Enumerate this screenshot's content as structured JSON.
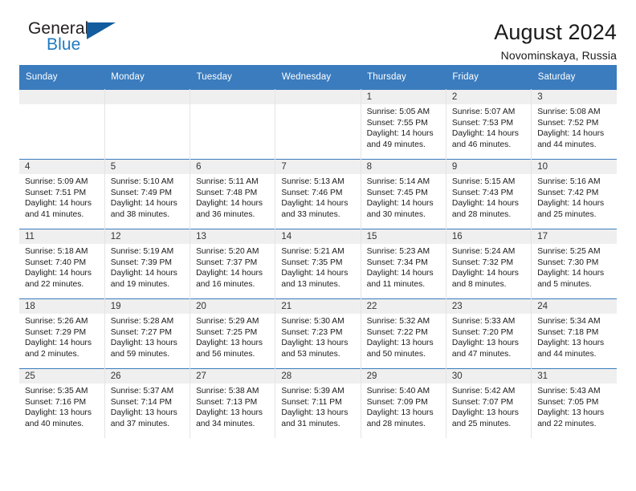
{
  "brand": {
    "name_part1": "General",
    "name_part2": "Blue",
    "accent_color": "#1f7bc1",
    "triangle_color": "#135d9e"
  },
  "header": {
    "title": "August 2024",
    "subtitle": "Novominskaya, Russia",
    "header_bg_color": "#3a7cbe"
  },
  "weekday_headers": [
    "Sunday",
    "Monday",
    "Tuesday",
    "Wednesday",
    "Thursday",
    "Friday",
    "Saturday"
  ],
  "labels": {
    "sunrise_prefix": "Sunrise:",
    "sunset_prefix": "Sunset:",
    "daylight_prefix": "Daylight:"
  },
  "weeks": [
    [
      {
        "day": "",
        "empty": true
      },
      {
        "day": "",
        "empty": true
      },
      {
        "day": "",
        "empty": true
      },
      {
        "day": "",
        "empty": true
      },
      {
        "day": "1",
        "sunrise": "Sunrise: 5:05 AM",
        "sunset": "Sunset: 7:55 PM",
        "daylight_line1": "Daylight: 14 hours",
        "daylight_line2": "and 49 minutes."
      },
      {
        "day": "2",
        "sunrise": "Sunrise: 5:07 AM",
        "sunset": "Sunset: 7:53 PM",
        "daylight_line1": "Daylight: 14 hours",
        "daylight_line2": "and 46 minutes."
      },
      {
        "day": "3",
        "sunrise": "Sunrise: 5:08 AM",
        "sunset": "Sunset: 7:52 PM",
        "daylight_line1": "Daylight: 14 hours",
        "daylight_line2": "and 44 minutes."
      }
    ],
    [
      {
        "day": "4",
        "sunrise": "Sunrise: 5:09 AM",
        "sunset": "Sunset: 7:51 PM",
        "daylight_line1": "Daylight: 14 hours",
        "daylight_line2": "and 41 minutes."
      },
      {
        "day": "5",
        "sunrise": "Sunrise: 5:10 AM",
        "sunset": "Sunset: 7:49 PM",
        "daylight_line1": "Daylight: 14 hours",
        "daylight_line2": "and 38 minutes."
      },
      {
        "day": "6",
        "sunrise": "Sunrise: 5:11 AM",
        "sunset": "Sunset: 7:48 PM",
        "daylight_line1": "Daylight: 14 hours",
        "daylight_line2": "and 36 minutes."
      },
      {
        "day": "7",
        "sunrise": "Sunrise: 5:13 AM",
        "sunset": "Sunset: 7:46 PM",
        "daylight_line1": "Daylight: 14 hours",
        "daylight_line2": "and 33 minutes."
      },
      {
        "day": "8",
        "sunrise": "Sunrise: 5:14 AM",
        "sunset": "Sunset: 7:45 PM",
        "daylight_line1": "Daylight: 14 hours",
        "daylight_line2": "and 30 minutes."
      },
      {
        "day": "9",
        "sunrise": "Sunrise: 5:15 AM",
        "sunset": "Sunset: 7:43 PM",
        "daylight_line1": "Daylight: 14 hours",
        "daylight_line2": "and 28 minutes."
      },
      {
        "day": "10",
        "sunrise": "Sunrise: 5:16 AM",
        "sunset": "Sunset: 7:42 PM",
        "daylight_line1": "Daylight: 14 hours",
        "daylight_line2": "and 25 minutes."
      }
    ],
    [
      {
        "day": "11",
        "sunrise": "Sunrise: 5:18 AM",
        "sunset": "Sunset: 7:40 PM",
        "daylight_line1": "Daylight: 14 hours",
        "daylight_line2": "and 22 minutes."
      },
      {
        "day": "12",
        "sunrise": "Sunrise: 5:19 AM",
        "sunset": "Sunset: 7:39 PM",
        "daylight_line1": "Daylight: 14 hours",
        "daylight_line2": "and 19 minutes."
      },
      {
        "day": "13",
        "sunrise": "Sunrise: 5:20 AM",
        "sunset": "Sunset: 7:37 PM",
        "daylight_line1": "Daylight: 14 hours",
        "daylight_line2": "and 16 minutes."
      },
      {
        "day": "14",
        "sunrise": "Sunrise: 5:21 AM",
        "sunset": "Sunset: 7:35 PM",
        "daylight_line1": "Daylight: 14 hours",
        "daylight_line2": "and 13 minutes."
      },
      {
        "day": "15",
        "sunrise": "Sunrise: 5:23 AM",
        "sunset": "Sunset: 7:34 PM",
        "daylight_line1": "Daylight: 14 hours",
        "daylight_line2": "and 11 minutes."
      },
      {
        "day": "16",
        "sunrise": "Sunrise: 5:24 AM",
        "sunset": "Sunset: 7:32 PM",
        "daylight_line1": "Daylight: 14 hours",
        "daylight_line2": "and 8 minutes."
      },
      {
        "day": "17",
        "sunrise": "Sunrise: 5:25 AM",
        "sunset": "Sunset: 7:30 PM",
        "daylight_line1": "Daylight: 14 hours",
        "daylight_line2": "and 5 minutes."
      }
    ],
    [
      {
        "day": "18",
        "sunrise": "Sunrise: 5:26 AM",
        "sunset": "Sunset: 7:29 PM",
        "daylight_line1": "Daylight: 14 hours",
        "daylight_line2": "and 2 minutes."
      },
      {
        "day": "19",
        "sunrise": "Sunrise: 5:28 AM",
        "sunset": "Sunset: 7:27 PM",
        "daylight_line1": "Daylight: 13 hours",
        "daylight_line2": "and 59 minutes."
      },
      {
        "day": "20",
        "sunrise": "Sunrise: 5:29 AM",
        "sunset": "Sunset: 7:25 PM",
        "daylight_line1": "Daylight: 13 hours",
        "daylight_line2": "and 56 minutes."
      },
      {
        "day": "21",
        "sunrise": "Sunrise: 5:30 AM",
        "sunset": "Sunset: 7:23 PM",
        "daylight_line1": "Daylight: 13 hours",
        "daylight_line2": "and 53 minutes."
      },
      {
        "day": "22",
        "sunrise": "Sunrise: 5:32 AM",
        "sunset": "Sunset: 7:22 PM",
        "daylight_line1": "Daylight: 13 hours",
        "daylight_line2": "and 50 minutes."
      },
      {
        "day": "23",
        "sunrise": "Sunrise: 5:33 AM",
        "sunset": "Sunset: 7:20 PM",
        "daylight_line1": "Daylight: 13 hours",
        "daylight_line2": "and 47 minutes."
      },
      {
        "day": "24",
        "sunrise": "Sunrise: 5:34 AM",
        "sunset": "Sunset: 7:18 PM",
        "daylight_line1": "Daylight: 13 hours",
        "daylight_line2": "and 44 minutes."
      }
    ],
    [
      {
        "day": "25",
        "sunrise": "Sunrise: 5:35 AM",
        "sunset": "Sunset: 7:16 PM",
        "daylight_line1": "Daylight: 13 hours",
        "daylight_line2": "and 40 minutes."
      },
      {
        "day": "26",
        "sunrise": "Sunrise: 5:37 AM",
        "sunset": "Sunset: 7:14 PM",
        "daylight_line1": "Daylight: 13 hours",
        "daylight_line2": "and 37 minutes."
      },
      {
        "day": "27",
        "sunrise": "Sunrise: 5:38 AM",
        "sunset": "Sunset: 7:13 PM",
        "daylight_line1": "Daylight: 13 hours",
        "daylight_line2": "and 34 minutes."
      },
      {
        "day": "28",
        "sunrise": "Sunrise: 5:39 AM",
        "sunset": "Sunset: 7:11 PM",
        "daylight_line1": "Daylight: 13 hours",
        "daylight_line2": "and 31 minutes."
      },
      {
        "day": "29",
        "sunrise": "Sunrise: 5:40 AM",
        "sunset": "Sunset: 7:09 PM",
        "daylight_line1": "Daylight: 13 hours",
        "daylight_line2": "and 28 minutes."
      },
      {
        "day": "30",
        "sunrise": "Sunrise: 5:42 AM",
        "sunset": "Sunset: 7:07 PM",
        "daylight_line1": "Daylight: 13 hours",
        "daylight_line2": "and 25 minutes."
      },
      {
        "day": "31",
        "sunrise": "Sunrise: 5:43 AM",
        "sunset": "Sunset: 7:05 PM",
        "daylight_line1": "Daylight: 13 hours",
        "daylight_line2": "and 22 minutes."
      }
    ]
  ]
}
